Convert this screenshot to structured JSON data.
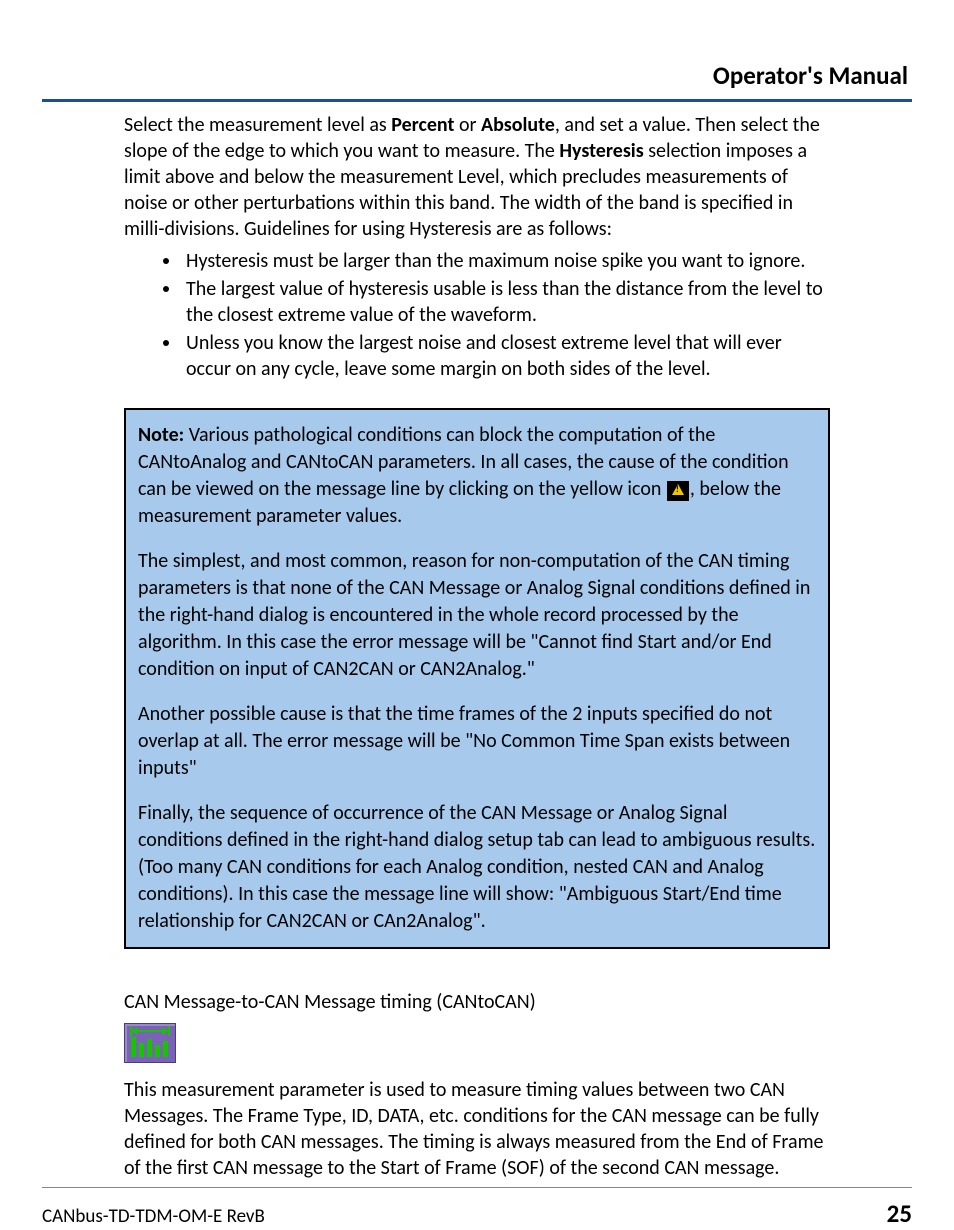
{
  "header": {
    "title": "Operator's Manual"
  },
  "intro": {
    "p1_a": "Select the measurement level as ",
    "p1_b": "Percent",
    "p1_c": " or ",
    "p1_d": "Absolute",
    "p1_e": ", and set a value. Then select the slope of the edge to which you want to measure. The ",
    "p1_f": "Hysteresis",
    "p1_g": " selection imposes a limit above and below the measurement Level, which precludes measurements of noise or other perturbations within this band. The width of the band is specified in milli-divisions. Guidelines for using Hysteresis are as follows:"
  },
  "bullets": [
    "Hysteresis must be larger than the maximum noise spike you want to ignore.",
    "The largest value of hysteresis usable is less than the distance from the level to the closest extreme value of the waveform.",
    "Unless you know the largest noise and closest extreme level that will ever occur on any cycle, leave some margin on both sides of the level."
  ],
  "note": {
    "label": "Note:",
    "p1_a": " Various pathological conditions can block the computation of the CANtoAnalog and CANtoCAN parameters. In all cases, the cause of the condition can be viewed on the message line by clicking on the yellow icon ",
    "p1_b": ", below the measurement parameter values.",
    "p2": "The simplest, and most common, reason for non-computation of the CAN timing parameters is that none of the CAN Message or Analog Signal conditions defined in the right-hand dialog is encountered in the whole record processed by the algorithm. In this case the error message will be \"Cannot find Start and/or End condition on input of CAN2CAN or CAN2Analog.\"",
    "p3": "Another possible cause is that the time frames of the 2 inputs specified do not overlap at all. The error message will be \"No Common Time Span exists between inputs\"",
    "p4": "Finally, the sequence of occurrence of the CAN Message or Analog Signal conditions defined in the right-hand dialog setup tab can lead to ambiguous results. (Too many CAN conditions for each Analog condition, nested CAN and Analog conditions). In this case the message line will show: \"Ambiguous Start/End time relationship for CAN2CAN or CAn2Analog\"."
  },
  "section2": {
    "heading": "CAN Message-to-CAN Message timing (CANtoCAN)",
    "body": "This measurement parameter is used to measure timing values between two CAN Messages. The Frame Type, ID, DATA, etc. conditions for the CAN message can be fully defined for both CAN messages. The timing is always measured from the End of Frame of the first CAN message to the Start of Frame (SOF) of the second CAN message."
  },
  "footer": {
    "doc_id": "CANbus-TD-TDM-OM-E RevB",
    "page": "25"
  }
}
